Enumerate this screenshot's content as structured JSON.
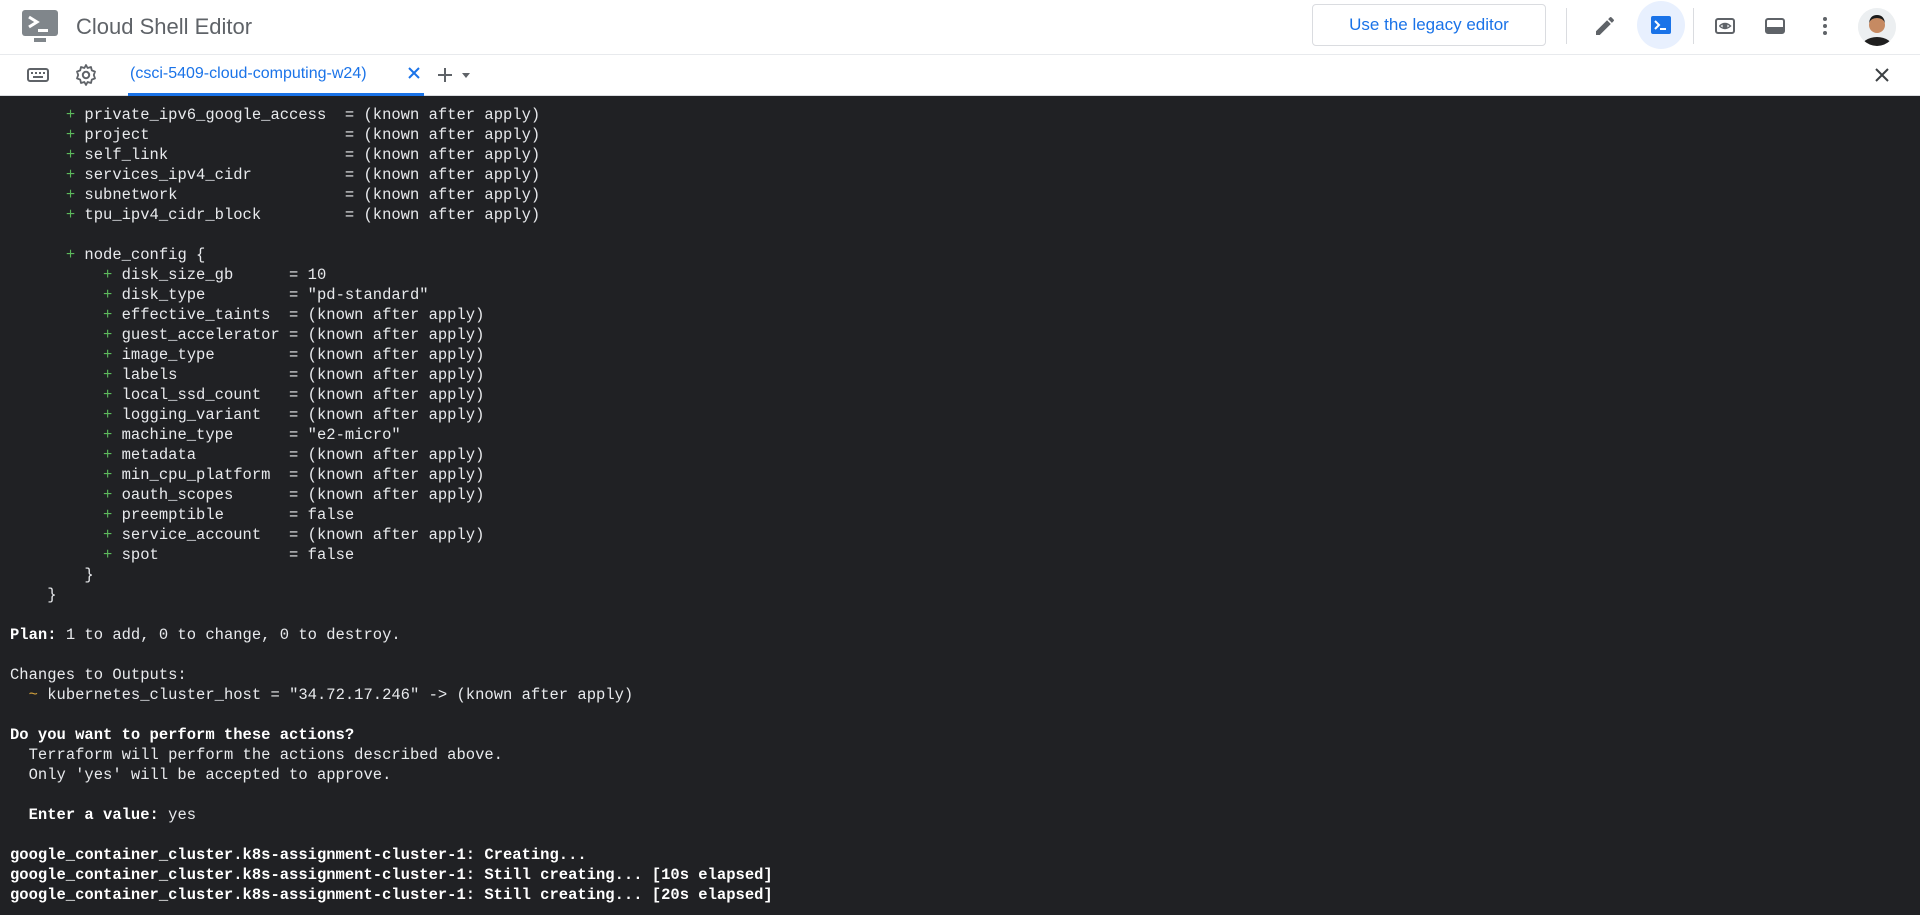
{
  "header": {
    "app_title": "Cloud Shell Editor",
    "legacy_button_label": "Use the legacy editor",
    "icons": [
      "edit-pencil-icon",
      "terminal-icon",
      "web-preview-icon",
      "panel-layout-icon",
      "more-vert-icon"
    ]
  },
  "tabbar": {
    "tab_label": "(csci-5409-cloud-computing-w24)",
    "icons": [
      "keyboard-icon",
      "settings-icon",
      "add-icon",
      "dropdown-arrow-icon",
      "close-terminal-icon"
    ]
  },
  "terminal": {
    "lines": [
      {
        "indent": "      ",
        "marker": "+",
        "text": " private_ipv6_google_access  = (known after apply)"
      },
      {
        "indent": "      ",
        "marker": "+",
        "text": " project                     = (known after apply)"
      },
      {
        "indent": "      ",
        "marker": "+",
        "text": " self_link                   = (known after apply)"
      },
      {
        "indent": "      ",
        "marker": "+",
        "text": " services_ipv4_cidr          = (known after apply)"
      },
      {
        "indent": "      ",
        "marker": "+",
        "text": " subnetwork                  = (known after apply)"
      },
      {
        "indent": "      ",
        "marker": "+",
        "text": " tpu_ipv4_cidr_block         = (known after apply)"
      },
      {
        "indent": "",
        "marker": "",
        "text": ""
      },
      {
        "indent": "      ",
        "marker": "+",
        "text": " node_config {"
      },
      {
        "indent": "          ",
        "marker": "+",
        "text": " disk_size_gb      = 10"
      },
      {
        "indent": "          ",
        "marker": "+",
        "text": " disk_type         = \"pd-standard\""
      },
      {
        "indent": "          ",
        "marker": "+",
        "text": " effective_taints  = (known after apply)"
      },
      {
        "indent": "          ",
        "marker": "+",
        "text": " guest_accelerator = (known after apply)"
      },
      {
        "indent": "          ",
        "marker": "+",
        "text": " image_type        = (known after apply)"
      },
      {
        "indent": "          ",
        "marker": "+",
        "text": " labels            = (known after apply)"
      },
      {
        "indent": "          ",
        "marker": "+",
        "text": " local_ssd_count   = (known after apply)"
      },
      {
        "indent": "          ",
        "marker": "+",
        "text": " logging_variant   = (known after apply)"
      },
      {
        "indent": "          ",
        "marker": "+",
        "text": " machine_type      = \"e2-micro\""
      },
      {
        "indent": "          ",
        "marker": "+",
        "text": " metadata          = (known after apply)"
      },
      {
        "indent": "          ",
        "marker": "+",
        "text": " min_cpu_platform  = (known after apply)"
      },
      {
        "indent": "          ",
        "marker": "+",
        "text": " oauth_scopes      = (known after apply)"
      },
      {
        "indent": "          ",
        "marker": "+",
        "text": " preemptible       = false"
      },
      {
        "indent": "          ",
        "marker": "+",
        "text": " service_account   = (known after apply)"
      },
      {
        "indent": "          ",
        "marker": "+",
        "text": " spot              = false"
      },
      {
        "indent": "        ",
        "marker": "",
        "text": "}"
      },
      {
        "indent": "    ",
        "marker": "",
        "text": "}"
      },
      {
        "indent": "",
        "marker": "",
        "text": ""
      },
      {
        "indent": "",
        "marker": "",
        "bold": "Plan:",
        "text": " 1 to add, 0 to change, 0 to destroy."
      },
      {
        "indent": "",
        "marker": "",
        "text": ""
      },
      {
        "indent": "",
        "marker": "",
        "text": "Changes to Outputs:"
      },
      {
        "indent": "  ",
        "marker": "~",
        "text": " kubernetes_cluster_host = \"34.72.17.246\" -> (known after apply)"
      },
      {
        "indent": "",
        "marker": "",
        "text": ""
      },
      {
        "indent": "",
        "marker": "",
        "bold": "Do you want to perform these actions?",
        "text": ""
      },
      {
        "indent": "  ",
        "marker": "",
        "text": "Terraform will perform the actions described above."
      },
      {
        "indent": "  ",
        "marker": "",
        "text": "Only 'yes' will be accepted to approve."
      },
      {
        "indent": "",
        "marker": "",
        "text": ""
      },
      {
        "indent": "  ",
        "marker": "",
        "bold": "Enter a value:",
        "text": " yes"
      },
      {
        "indent": "",
        "marker": "",
        "text": ""
      },
      {
        "indent": "",
        "marker": "",
        "bold": "google_container_cluster.k8s-assignment-cluster-1: Creating...",
        "text": ""
      },
      {
        "indent": "",
        "marker": "",
        "bold": "google_container_cluster.k8s-assignment-cluster-1: Still creating... [10s elapsed]",
        "text": ""
      },
      {
        "indent": "",
        "marker": "",
        "bold": "google_container_cluster.k8s-assignment-cluster-1: Still creating... [20s elapsed]",
        "text": ""
      }
    ]
  },
  "colors": {
    "accent": "#1a73e8",
    "terminal_bg": "#202124",
    "plus_marker": "#5cb85c",
    "tilde_marker": "#d7a43c"
  }
}
